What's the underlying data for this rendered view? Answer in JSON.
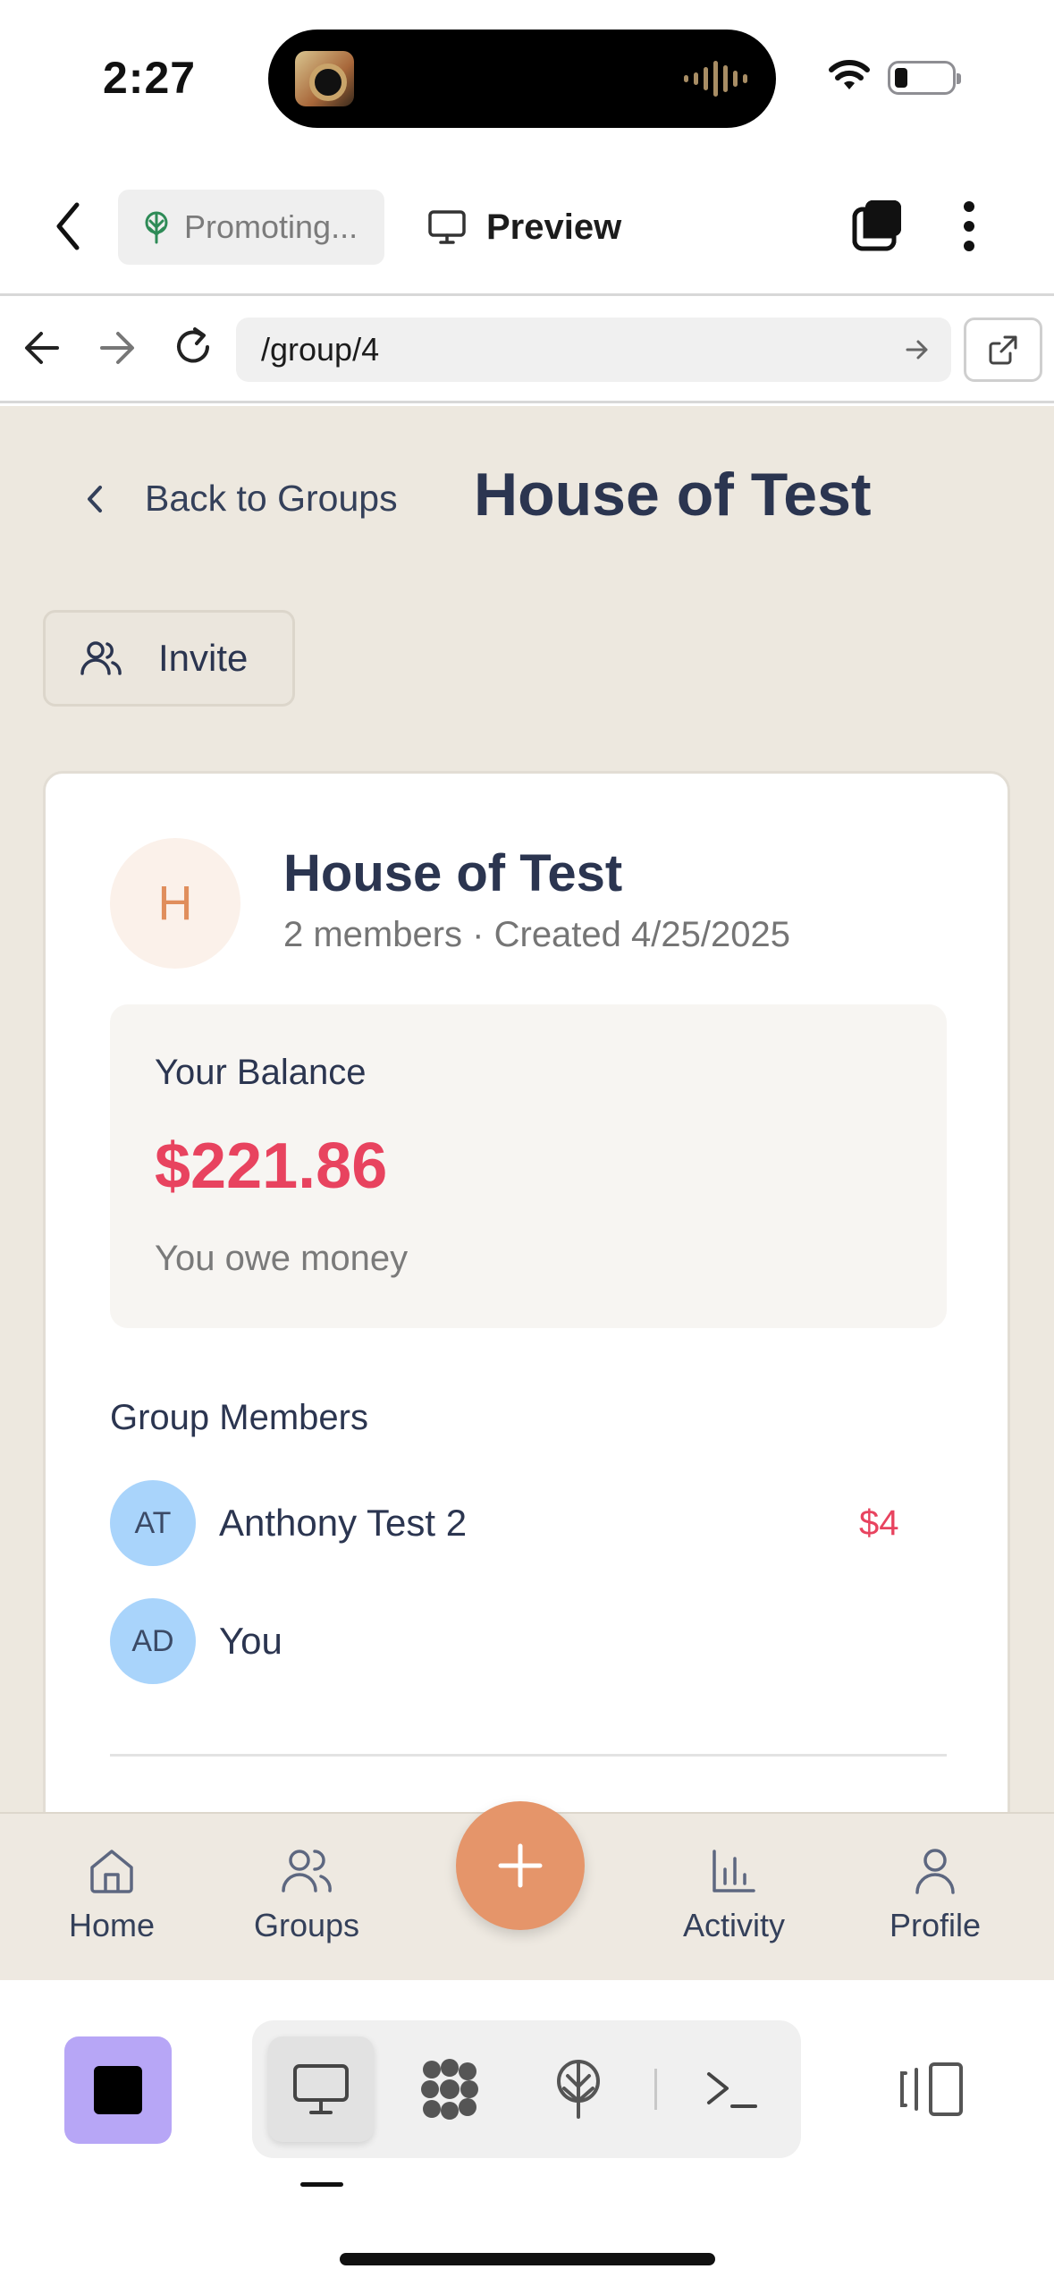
{
  "status_bar": {
    "time": "2:27"
  },
  "app_bar": {
    "project_label": "Promoting...",
    "preview_label": "Preview"
  },
  "browser": {
    "url": "/group/4"
  },
  "page": {
    "back_label": "Back to Groups",
    "title": "House of Test",
    "invite_label": "Invite"
  },
  "group": {
    "avatar_letter": "H",
    "name": "House of Test",
    "meta": "2 members · Created 4/25/2025"
  },
  "balance": {
    "label": "Your Balance",
    "amount": "$221.86",
    "status": "You owe money"
  },
  "members": {
    "heading": "Group Members",
    "items": [
      {
        "initials": "AT",
        "name": "Anthony Test 2",
        "amount": "$4"
      },
      {
        "initials": "AD",
        "name": "You",
        "amount": ""
      }
    ]
  },
  "bottom_nav": {
    "items": [
      {
        "label": "Home",
        "icon": "home-icon"
      },
      {
        "label": "Groups",
        "icon": "users-icon"
      },
      {
        "label": "Activity",
        "icon": "bar-chart-icon"
      },
      {
        "label": "Profile",
        "icon": "user-icon"
      }
    ]
  },
  "colors": {
    "accent": "#e5956a",
    "negative": "#e8435f",
    "page_background": "#ede8df",
    "heading": "#2b3550"
  }
}
